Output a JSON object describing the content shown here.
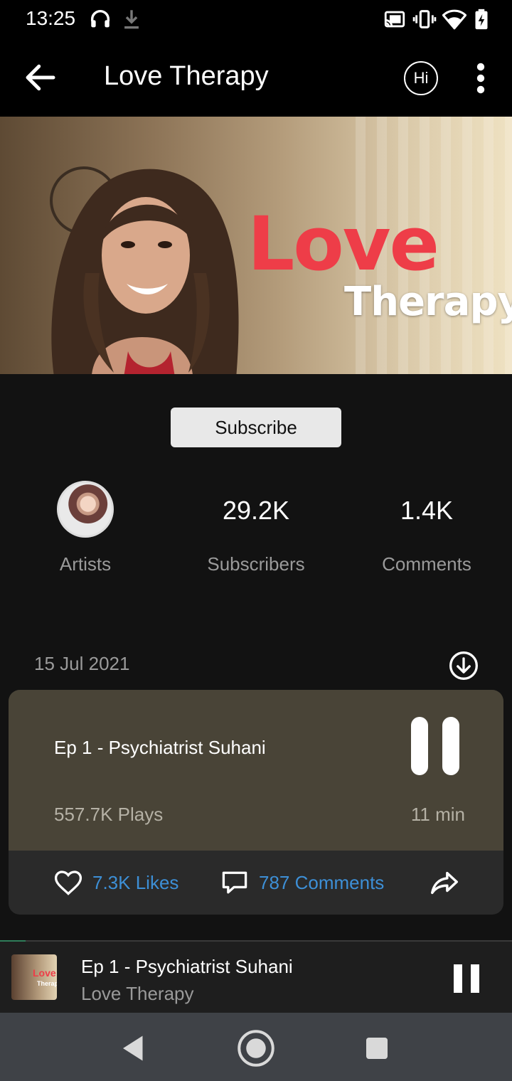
{
  "status_bar": {
    "time": "13:25",
    "icons": [
      "headphones-icon",
      "download-icon",
      "cast-icon",
      "vibrate-icon",
      "wifi-icon",
      "battery-charging-icon"
    ]
  },
  "app_bar": {
    "title": "Love Therapy",
    "language_button": "Hi",
    "icons": [
      "back-arrow-icon",
      "more-vert-icon"
    ]
  },
  "banner": {
    "title_line1": "Love",
    "title_line2": "Therapy"
  },
  "subscribe_label": "Subscribe",
  "stats": {
    "artists_label": "Artists",
    "subscribers_value": "29.2K",
    "subscribers_label": "Subscribers",
    "comments_value": "1.4K",
    "comments_label": "Comments"
  },
  "episode": {
    "date": "15 Jul 2021",
    "title": "Ep 1 - Psychiatrist Suhani",
    "plays": "557.7K  Plays",
    "duration": "11 min",
    "likes": "7.3K Likes",
    "comments": "787 Comments",
    "icons": [
      "download-circle-icon",
      "pause-icon",
      "heart-icon",
      "comment-icon",
      "share-icon"
    ]
  },
  "mini_player": {
    "title": "Ep 1 - Psychiatrist Suhani",
    "subtitle": "Love Therapy",
    "thumb_line1": "Love",
    "thumb_line2": "Therapy"
  },
  "colors": {
    "background": "#121212",
    "card_top": "#494437",
    "card_bottom": "#2a2a2a",
    "link_blue": "#3d8fd6",
    "brand_red": "#ee3d48"
  }
}
